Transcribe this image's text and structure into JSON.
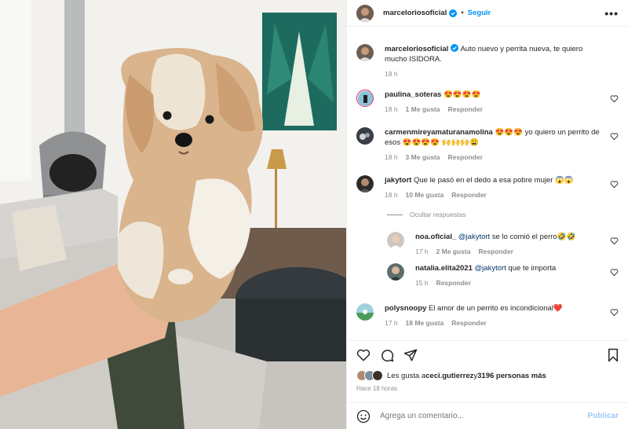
{
  "post": {
    "username": "marceloriosoficial",
    "follow_label": "Seguir",
    "more_label": "•••",
    "caption": "Auto nuevo y perrita nueva, te quiero mucho ISIDORA.",
    "caption_time": "18 h"
  },
  "comments": [
    {
      "username": "paulina_soteras",
      "text": "😍😍😍😍",
      "time": "18 h",
      "likes": "1 Me gusta",
      "reply": "Responder"
    },
    {
      "username": "carmenmireyamaturanamolina",
      "text": "😍😍😍 yo quiero un perrito de esos 😍😍😍😍 🙌🙌🙌😩",
      "time": "18 h",
      "likes": "3 Me gusta",
      "reply": "Responder"
    },
    {
      "username": "jakytort",
      "text": "Que le pasó en el dedo a esa pobre mujer 😱😱",
      "time": "18 h",
      "likes": "10 Me gusta",
      "reply": "Responder"
    }
  ],
  "hide_replies_label": "Ocultar respuestas",
  "replies": [
    {
      "username": "noa.oficial_",
      "mention": "@jakytort",
      "text": " se lo comió el perro🤣🤣",
      "time": "17 h",
      "likes": "2 Me gusta",
      "reply": "Responder"
    },
    {
      "username": "natalia.elita2021",
      "mention": "@jakytort",
      "text": " que te importa",
      "time": "15 h",
      "reply": "Responder"
    }
  ],
  "last_comment": {
    "username": "polysnoopy",
    "text": "El amor de un perrito es incondicional❤️",
    "time": "17 h",
    "likes": "18 Me gusta",
    "reply": "Responder"
  },
  "likes_line": {
    "prefix": "Les gusta a ",
    "user": "ceci.gutierrez",
    "middle": " y ",
    "count": "3196 personas más"
  },
  "posted_ago": "Hace 18 horas",
  "composer": {
    "placeholder": "Agrega un comentario...",
    "publish_label": "Publicar"
  },
  "colors": {
    "accent": "#0095f6",
    "publish_disabled": "#9cc9f7",
    "verified": "#0095f6",
    "heart_red": "#e0245e"
  }
}
